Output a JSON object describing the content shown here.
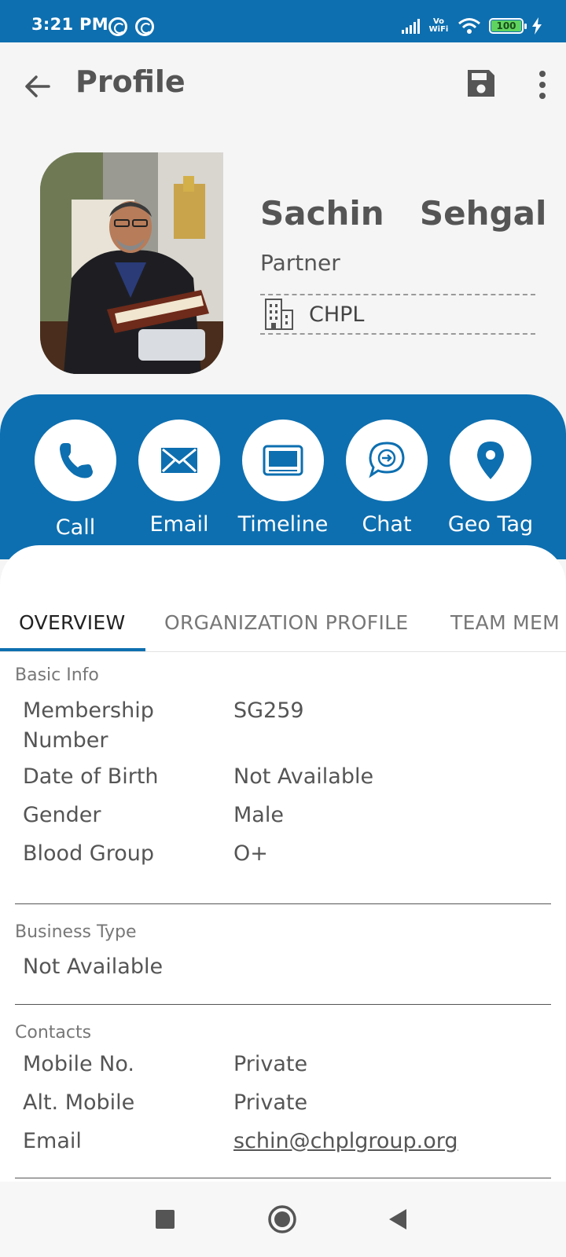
{
  "status_bar": {
    "time": "3:21 PM",
    "vo_wifi": "Vo WiFi",
    "battery": "100",
    "icons": [
      "notification-icon",
      "notification-icon",
      "signal-icon",
      "vowifi-icon",
      "wifi-icon",
      "battery-icon",
      "charging-icon"
    ]
  },
  "app_bar": {
    "title": "Profile",
    "icons": {
      "back": "arrow-left-icon",
      "save": "save-icon",
      "more": "more-vert-icon"
    }
  },
  "profile": {
    "name": "Sachin  Sehgal",
    "role": "Partner",
    "organization": "CHPL"
  },
  "actions": [
    {
      "label": "Call",
      "icon": "phone-icon"
    },
    {
      "label": "Email",
      "icon": "mail-icon"
    },
    {
      "label": "Timeline",
      "icon": "timeline-icon"
    },
    {
      "label": "Chat",
      "icon": "chat-icon"
    },
    {
      "label": "Geo Tag",
      "icon": "location-pin-icon"
    }
  ],
  "tabs": [
    {
      "label": "OVERVIEW",
      "active": true
    },
    {
      "label": "ORGANIZATION PROFILE",
      "active": false
    },
    {
      "label": "TEAM MEM",
      "active": false
    }
  ],
  "basic_info": {
    "title": "Basic Info",
    "rows": [
      {
        "label": "Membership Number",
        "value": "SG259"
      },
      {
        "label": "Date of Birth",
        "value": "Not Available"
      },
      {
        "label": "Gender",
        "value": "Male"
      },
      {
        "label": "Blood Group",
        "value": "O+"
      }
    ]
  },
  "business_type": {
    "title": "Business Type",
    "value": "Not Available"
  },
  "contacts": {
    "title": "Contacts",
    "rows": [
      {
        "label": "Mobile No.",
        "value": "Private"
      },
      {
        "label": "Alt. Mobile",
        "value": "Private"
      },
      {
        "label": "Email",
        "value": "schin@chplgroup.org"
      }
    ]
  },
  "colors": {
    "primary": "#0d6fb0",
    "text": "#555555",
    "background": "#f5f5f5"
  }
}
